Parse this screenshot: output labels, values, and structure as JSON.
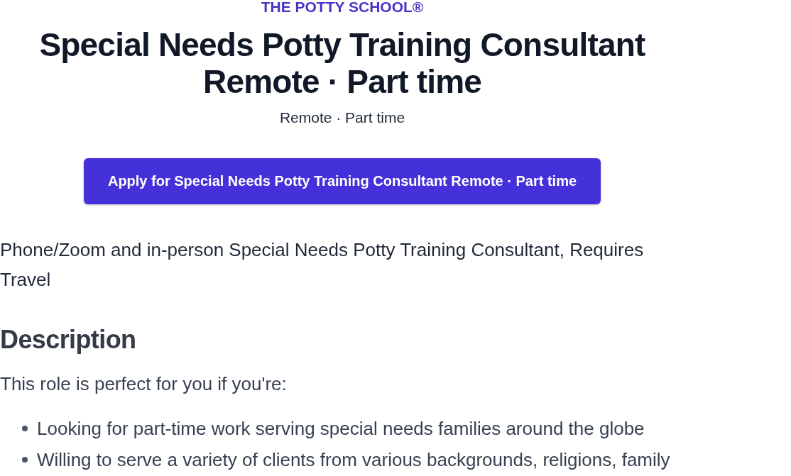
{
  "header": {
    "company": "THE POTTY SCHOOL®",
    "title": "Special Needs Potty Training Consultant Remote · Part time",
    "subtitle": "Remote · Part time"
  },
  "apply_button": {
    "label": "Apply for Special Needs Potty Training Consultant Remote · Part time"
  },
  "summary": "Phone/Zoom and in-person Special Needs Potty Training Consultant, Requires Travel",
  "description": {
    "heading": "Description",
    "intro": "This role is perfect for you if you're:",
    "bullets": [
      "Looking for part-time work serving special needs families around the globe",
      "Willing to serve a variety of clients from various backgrounds, religions, family"
    ]
  }
}
